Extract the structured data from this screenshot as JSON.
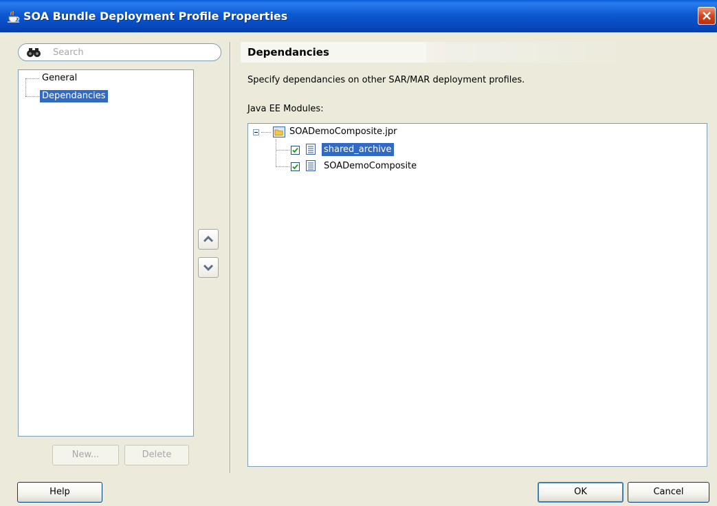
{
  "window": {
    "title": "SOA Bundle Deployment Profile Properties",
    "icon": "java-cup-icon"
  },
  "search": {
    "placeholder": "Search"
  },
  "nav": {
    "items": [
      {
        "label": "General",
        "selected": false
      },
      {
        "label": "Dependancies",
        "selected": true
      }
    ],
    "new_label": "New...",
    "delete_label": "Delete"
  },
  "reorder": {
    "up_icon": "chevron-up-icon",
    "down_icon": "chevron-down-icon"
  },
  "panel": {
    "title": "Dependancies",
    "description": "Specify dependancies on other SAR/MAR deployment profiles.",
    "modules_label": "Java EE Modules:",
    "tree": {
      "root": {
        "label": "SOADemoComposite.jpr",
        "expanded": true
      },
      "children": [
        {
          "label": "shared_archive",
          "checked": true,
          "selected": true
        },
        {
          "label": "SOADemoComposite",
          "checked": true,
          "selected": false
        }
      ]
    }
  },
  "footer": {
    "help_label": "Help",
    "ok_label": "OK",
    "cancel_label": "Cancel"
  },
  "colors": {
    "titlebar": "#0a5fd8",
    "selection": "#316ac5",
    "dialog_bg": "#ebeadb"
  }
}
